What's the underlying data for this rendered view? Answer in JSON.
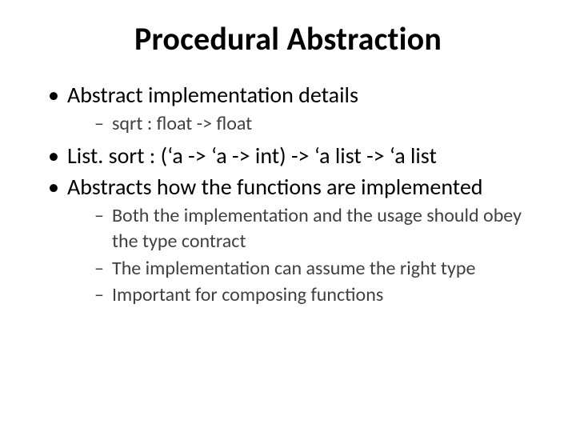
{
  "title": "Procedural Abstraction",
  "bullets": {
    "b1": "Abstract implementation details",
    "b1_sub1": "sqrt : float -> float",
    "b2": "List. sort : (‘a -> ‘a -> int) ->  ‘a list -> ‘a list",
    "b3": "Abstracts how the functions are implemented",
    "b3_sub1": "Both the implementation and the usage should obey the type contract",
    "b3_sub2": "The implementation can assume the right type",
    "b3_sub3": "Important for composing functions"
  }
}
